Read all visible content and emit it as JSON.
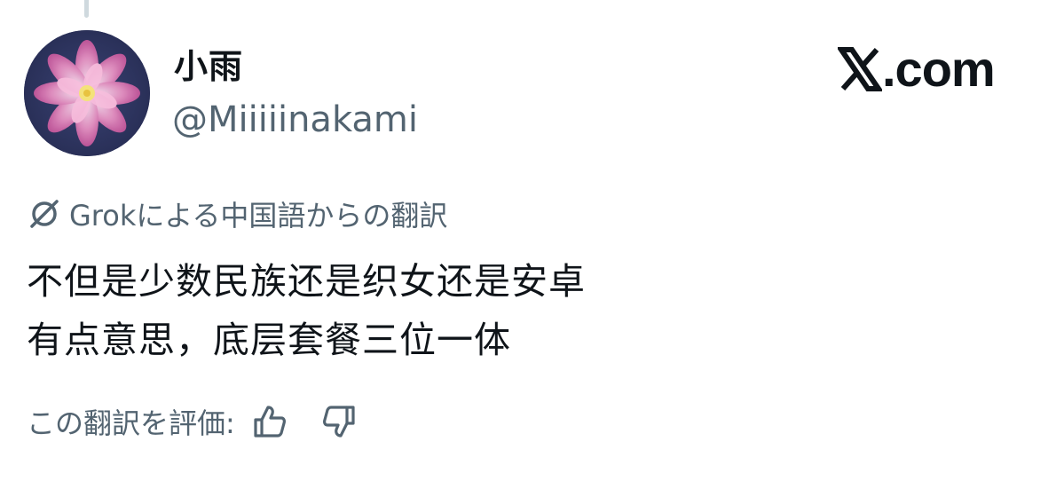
{
  "post": {
    "display_name": "小雨",
    "handle": "@Miiiiinakami",
    "brand": "X.com",
    "brand_suffix": ".com",
    "translation_label": "Grokによる中国語からの翻訳",
    "text_lines": [
      "不但是少数民族还是织女还是安卓",
      "有点意思，底层套餐三位一体"
    ],
    "rate_prompt": "この翻訳を評価:"
  },
  "icons": {
    "avatar": "lotus-flower-avatar",
    "grok": "grok-icon",
    "thumbs_up": "thumbs-up-icon",
    "thumbs_down": "thumbs-down-icon",
    "x_logo": "x-logo-icon"
  },
  "colors": {
    "text_primary": "#0f1419",
    "text_secondary": "#536471",
    "avatar_bg": "#2e3560",
    "lotus_pink": "#e58fc0"
  }
}
